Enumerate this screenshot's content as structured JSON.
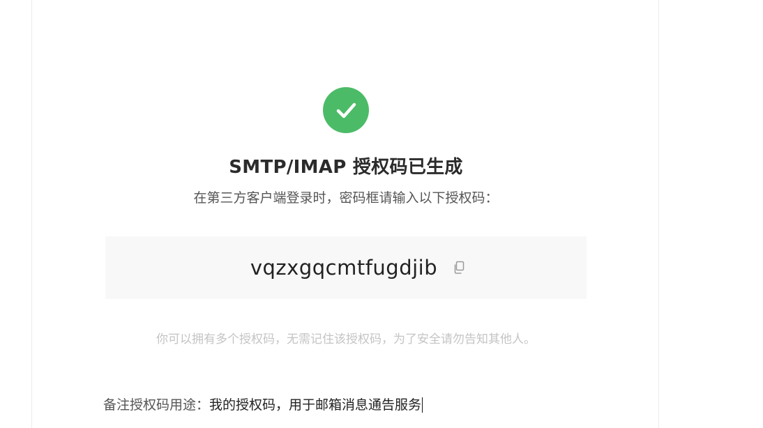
{
  "result": {
    "icon": "check-circle-icon",
    "success_color": "#4cbb67",
    "title": "SMTP/IMAP 授权码已生成",
    "subtitle": "在第三方客户端登录时，密码框请输入以下授权码："
  },
  "auth_code": {
    "value": "vqzxgqcmtfugdjib",
    "copy_icon": "copy-icon"
  },
  "hint": "你可以拥有多个授权码，无需记住该授权码，为了安全请勿告知其他人。",
  "note": {
    "label": "备注授权码用途：",
    "value": "我的授权码，用于邮箱消息通告服务"
  }
}
